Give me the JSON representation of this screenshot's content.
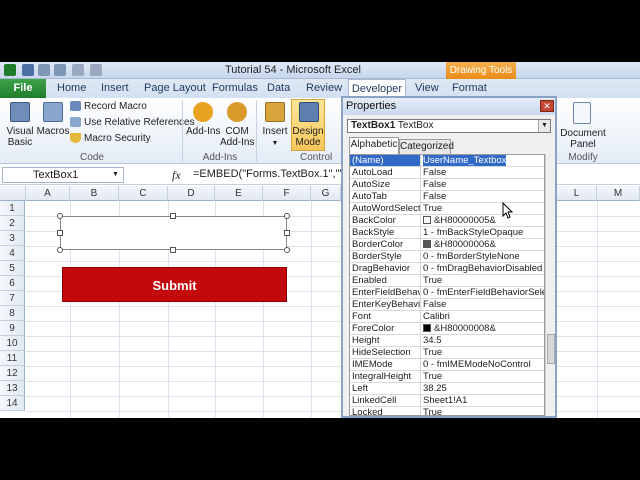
{
  "title": "Tutorial 54  -  Microsoft Excel",
  "contextual_tab": "Drawing Tools",
  "tabs": {
    "file": "File",
    "home": "Home",
    "insert": "Insert",
    "page_layout": "Page Layout",
    "formulas": "Formulas",
    "data": "Data",
    "review": "Review",
    "developer": "Developer",
    "view": "View",
    "format": "Format"
  },
  "ribbon": {
    "code_group": {
      "visual_basic": "Visual\nBasic",
      "macros": "Macros",
      "record_macro": "Record Macro",
      "relative_refs": "Use Relative References",
      "macro_security": "Macro Security",
      "label": "Code"
    },
    "addins_group": {
      "addins": "Add-Ins",
      "com_addins": "COM\nAdd-Ins",
      "label": "Add-Ins"
    },
    "controls_group": {
      "insert": "Insert",
      "design_mode": "Design\nMode",
      "label": "Control"
    },
    "modify_group": {
      "document_panel": "Document\nPanel",
      "label": "Modify"
    }
  },
  "formula_bar": {
    "name_box": "TextBox1",
    "fx": "fx",
    "formula": "=EMBED(\"Forms.TextBox.1\",\"\")"
  },
  "sheet": {
    "columns": [
      "A",
      "B",
      "C",
      "D",
      "E",
      "F",
      "G",
      "L",
      "M"
    ],
    "rows": [
      "1",
      "2",
      "3",
      "4",
      "5",
      "6",
      "7",
      "8",
      "9",
      "10",
      "11",
      "12",
      "13",
      "14"
    ],
    "submit_label": "Submit"
  },
  "properties": {
    "title": "Properties",
    "object_name": "TextBox1",
    "object_type": "TextBox",
    "tab_alpha": "Alphabetic",
    "tab_cat": "Categorized",
    "rows": [
      {
        "name": "(Name)",
        "value": "UserName_Textbox"
      },
      {
        "name": "AutoLoad",
        "value": "False"
      },
      {
        "name": "AutoSize",
        "value": "False"
      },
      {
        "name": "AutoTab",
        "value": "False"
      },
      {
        "name": "AutoWordSelect",
        "value": "True"
      },
      {
        "name": "BackColor",
        "value": "&H80000005&"
      },
      {
        "name": "BackStyle",
        "value": "1 - fmBackStyleOpaque"
      },
      {
        "name": "BorderColor",
        "value": "&H80000006&"
      },
      {
        "name": "BorderStyle",
        "value": "0 - fmBorderStyleNone"
      },
      {
        "name": "DragBehavior",
        "value": "0 - fmDragBehaviorDisabled"
      },
      {
        "name": "Enabled",
        "value": "True"
      },
      {
        "name": "EnterFieldBehavior",
        "value": "0 - fmEnterFieldBehaviorSelect"
      },
      {
        "name": "EnterKeyBehavior",
        "value": "False"
      },
      {
        "name": "Font",
        "value": "Calibri"
      },
      {
        "name": "ForeColor",
        "value": "&H80000008&"
      },
      {
        "name": "Height",
        "value": "34.5"
      },
      {
        "name": "HideSelection",
        "value": "True"
      },
      {
        "name": "IMEMode",
        "value": "0 - fmIMEModeNoControl"
      },
      {
        "name": "IntegralHeight",
        "value": "True"
      },
      {
        "name": "Left",
        "value": "38.25"
      },
      {
        "name": "LinkedCell",
        "value": "Sheet1!A1"
      },
      {
        "name": "Locked",
        "value": "True"
      }
    ]
  },
  "colors": {
    "submit_bg": "#c3090c",
    "selection": "#3169c6",
    "backcolor_swatch": "#ffffff",
    "bordercolor_swatch": "#555555",
    "forecolor_swatch": "#000000"
  }
}
